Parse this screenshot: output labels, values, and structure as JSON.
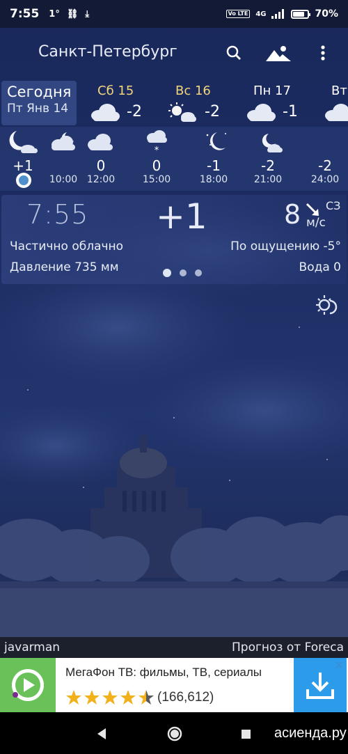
{
  "status_bar": {
    "time": "7:55",
    "temp_indicator": "1°",
    "network_badge": "Vo LTE",
    "network_type": "4G",
    "battery": "70%",
    "battery_level": 0.7
  },
  "header": {
    "city": "Санкт-Петербург",
    "search_icon": "search-icon",
    "landscape_icon": "landscape-icon",
    "menu_icon": "more-vert-icon"
  },
  "days": {
    "today_label": "Сегодня",
    "today_date": "Пт Янв 14",
    "items": [
      {
        "name": "Сб 15",
        "temp": "-2",
        "icon": "cloud-icon",
        "highlight": true
      },
      {
        "name": "Вс 16",
        "temp": "-2",
        "icon": "sun-cloud-icon",
        "highlight": true
      },
      {
        "name": "Пн 17",
        "temp": "-1",
        "icon": "cloud-icon",
        "highlight": false
      },
      {
        "name": "Вт",
        "temp": "",
        "icon": "cloud-icon",
        "highlight": false
      }
    ]
  },
  "hourly": [
    {
      "time": "",
      "temp": "+1",
      "icon": "moon-cloud-icon"
    },
    {
      "time": "10:00",
      "temp": "",
      "icon": "moon-cloud-icon"
    },
    {
      "time": "12:00",
      "temp": "0",
      "icon": "cloud-icon"
    },
    {
      "time": "15:00",
      "temp": "0",
      "icon": "snow-cloud-icon"
    },
    {
      "time": "18:00",
      "temp": "-1",
      "icon": "moon-stars-icon"
    },
    {
      "time": "21:00",
      "temp": "-2",
      "icon": "moon-cloud-icon"
    },
    {
      "time": "24:00",
      "temp": "-2",
      "icon": "moon-cloud-icon"
    }
  ],
  "current": {
    "time": "7:55",
    "temp": "+1",
    "wind_speed": "8",
    "wind_dir": "СЗ",
    "wind_unit": "м/с",
    "condition": "Частично облачно",
    "pressure": "Давление 735 мм",
    "feels_like": "По ощущению -5°",
    "water": "Вода 0"
  },
  "credits": {
    "left": "javarman",
    "right": "Прогноз от Foreca"
  },
  "ad": {
    "title": "МегаФон ТВ: фильмы, ТВ, сериалы",
    "rating_count": "(166,612)",
    "stars": 4.5,
    "accent": "#2b9bea",
    "icon_bg": "#6ac15a",
    "close": "✕"
  },
  "watermark": "асиенда.ру",
  "colors": {
    "sky": "#1d2d63",
    "day_highlight": "#f2d57a",
    "status_bar": "#131a35"
  }
}
